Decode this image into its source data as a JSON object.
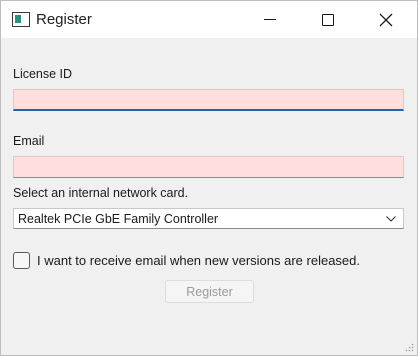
{
  "window": {
    "title": "Register",
    "icon": "app-window-icon",
    "controls": [
      "minimize-icon",
      "maximize-icon",
      "close-icon"
    ]
  },
  "form": {
    "license_label": "License ID",
    "license_value": "",
    "email_label": "Email",
    "email_value": "",
    "nic_label": "Select an internal network card.",
    "nic_selected": "Realtek PCIe GbE Family Controller",
    "checkbox_label": "I want to receive email when new versions are released.",
    "checkbox_checked": false,
    "register_label": "Register",
    "register_enabled": false
  },
  "colors": {
    "invalid_field_bg": "#ffdede",
    "focus_underline": "#1e63b0",
    "disabled_text": "#9a9a9a"
  }
}
